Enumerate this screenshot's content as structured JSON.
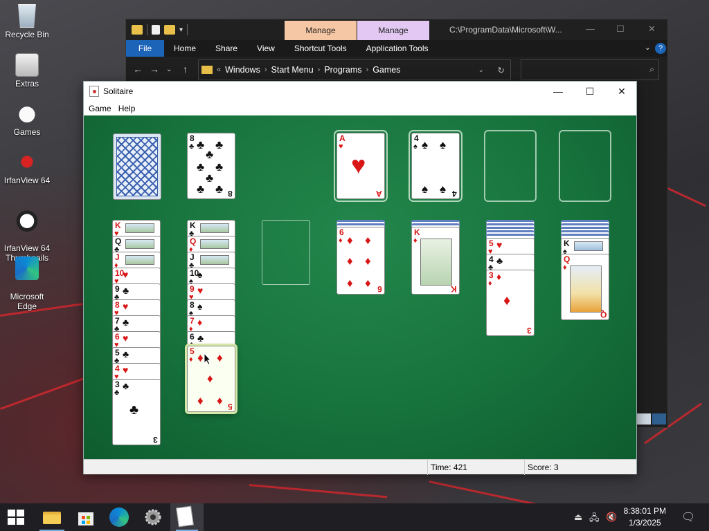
{
  "desktop": {
    "icons": [
      {
        "label": "Recycle Bin"
      },
      {
        "label": "Extras"
      },
      {
        "label": "Games"
      },
      {
        "label": "IrfanView 64"
      },
      {
        "label": "IrfanView 64\nThumbnails"
      },
      {
        "label": "Microsoft\nEdge"
      }
    ]
  },
  "explorer": {
    "manage_1": "Manage",
    "manage_2": "Manage",
    "title": "C:\\ProgramData\\Microsoft\\W...",
    "ribbon": {
      "file": "File",
      "home": "Home",
      "share": "Share",
      "view": "View",
      "shortcut_tools": "Shortcut Tools",
      "application_tools": "Application Tools",
      "help": "?"
    },
    "address": {
      "segments": [
        "Windows",
        "Start Menu",
        "Programs",
        "Games"
      ]
    }
  },
  "solitaire": {
    "title": "Solitaire",
    "menu": {
      "game": "Game",
      "help": "Help"
    },
    "status": {
      "time_label": "Time:",
      "time_value": "421",
      "score_label": "Score:",
      "score_value": "3"
    },
    "stock_waste": {
      "waste_rank": "8",
      "waste_suit": "♣"
    },
    "foundations": [
      {
        "rank": "A",
        "suit": "♥"
      },
      {
        "rank": "4",
        "suit": "♠"
      }
    ],
    "tableau_1": [
      {
        "rank": "K",
        "suit": "♥"
      },
      {
        "rank": "Q",
        "suit": "♣"
      },
      {
        "rank": "J",
        "suit": "♦"
      },
      {
        "rank": "10",
        "suit": "♥"
      },
      {
        "rank": "9",
        "suit": "♣"
      },
      {
        "rank": "8",
        "suit": "♥"
      },
      {
        "rank": "7",
        "suit": "♣"
      },
      {
        "rank": "6",
        "suit": "♥"
      },
      {
        "rank": "5",
        "suit": "♣"
      },
      {
        "rank": "4",
        "suit": "♥"
      },
      {
        "rank": "3",
        "suit": "♣"
      }
    ],
    "tableau_2": [
      {
        "rank": "K",
        "suit": "♣"
      },
      {
        "rank": "Q",
        "suit": "♦"
      },
      {
        "rank": "J",
        "suit": "♣"
      },
      {
        "rank": "10",
        "suit": "♠"
      },
      {
        "rank": "9",
        "suit": "♥"
      },
      {
        "rank": "8",
        "suit": "♠"
      },
      {
        "rank": "7",
        "suit": "♦"
      },
      {
        "rank": "6",
        "suit": "♣"
      }
    ],
    "dragged_card": {
      "rank": "5",
      "suit": "♦"
    },
    "tableau_4_top": {
      "rank": "6",
      "suit": "♦"
    },
    "tableau_5_top": {
      "rank": "K",
      "suit": "♦"
    },
    "tableau_6": [
      {
        "rank": "5",
        "suit": "♥"
      },
      {
        "rank": "4",
        "suit": "♣"
      },
      {
        "rank": "3",
        "suit": "♦"
      }
    ],
    "tableau_7": [
      {
        "rank": "K",
        "suit": "♠"
      },
      {
        "rank": "Q",
        "suit": "♦"
      }
    ]
  },
  "taskbar": {
    "time": "8:38:01 PM",
    "date": "1/3/2025"
  }
}
